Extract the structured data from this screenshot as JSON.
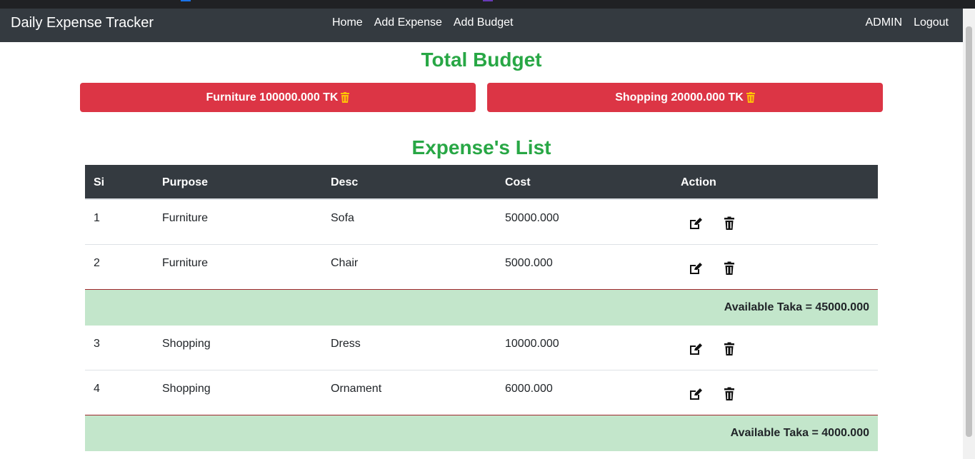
{
  "navbar": {
    "brand": "Daily Expense Tracker",
    "links": [
      "Home",
      "Add Expense",
      "Add Budget"
    ],
    "user": "ADMIN",
    "logout": "Logout"
  },
  "budget": {
    "heading": "Total Budget",
    "items": [
      "Furniture 100000.000 TK",
      "Shopping 20000.000 TK"
    ]
  },
  "expenses": {
    "heading": "Expense's List",
    "columns": [
      "Si",
      "Purpose",
      "Desc",
      "Cost",
      "Action"
    ],
    "groups": [
      {
        "rows": [
          {
            "si": "1",
            "purpose": "Furniture",
            "desc": "Sofa",
            "cost": "50000.000"
          },
          {
            "si": "2",
            "purpose": "Furniture",
            "desc": "Chair",
            "cost": "5000.000"
          }
        ],
        "available": "Available Taka = 45000.000"
      },
      {
        "rows": [
          {
            "si": "3",
            "purpose": "Shopping",
            "desc": "Dress",
            "cost": "10000.000"
          },
          {
            "si": "4",
            "purpose": "Shopping",
            "desc": "Ornament",
            "cost": "6000.000"
          }
        ],
        "available": "Available Taka = 4000.000"
      }
    ]
  },
  "colors": {
    "navbar": "#343a40",
    "heading": "#28a745",
    "budget_button": "#dc3545",
    "trash_accent": "#ffc107",
    "available_row": "#c3e6cb"
  }
}
